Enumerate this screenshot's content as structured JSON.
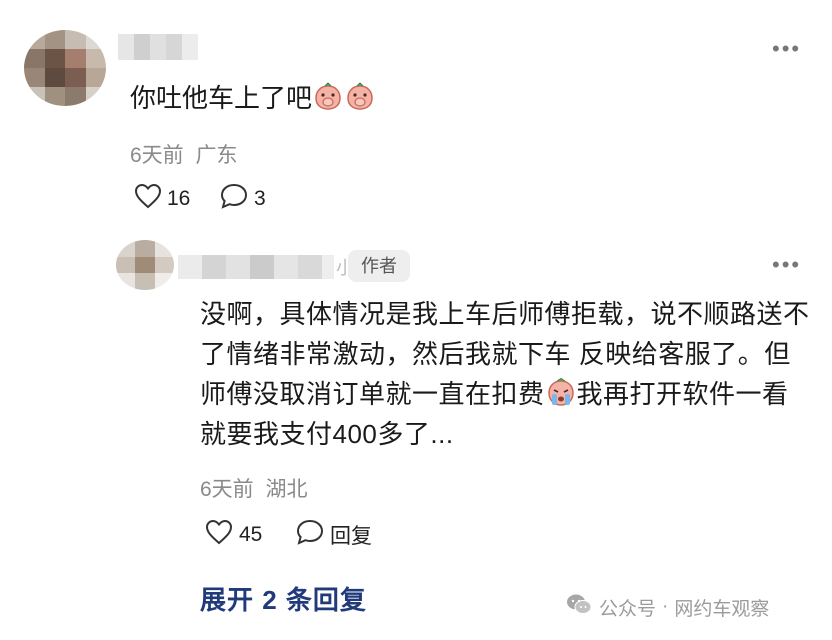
{
  "comment": {
    "text": "你吐他车上了吧",
    "time": "6天前",
    "location": "广东",
    "likes": "16",
    "replies": "3",
    "emoji_icons": [
      "face-covering-mouth-emoji",
      "face-covering-mouth-emoji"
    ]
  },
  "reply": {
    "author_tag": "作者",
    "name_tail": "小",
    "text_part1": "没啊，具体情况是我上车后师傅拒载，说不顺路送不了情绪非常激动，然后我就下车 反映给客服了。但师傅没取消订单就一直在扣费",
    "text_part2": "我再打开软件一看就要我支付400多了...",
    "emoji_icon": "crying-face-emoji",
    "time": "6天前",
    "location": "湖北",
    "likes": "45",
    "reply_label": "回复"
  },
  "expand_label": "展开 2 条回复",
  "watermark": {
    "prefix": "公众号",
    "sep": "·",
    "name": "网约车观察"
  },
  "colors": {
    "link_blue": "#203a7a",
    "meta_gray": "#8a8a8a"
  }
}
